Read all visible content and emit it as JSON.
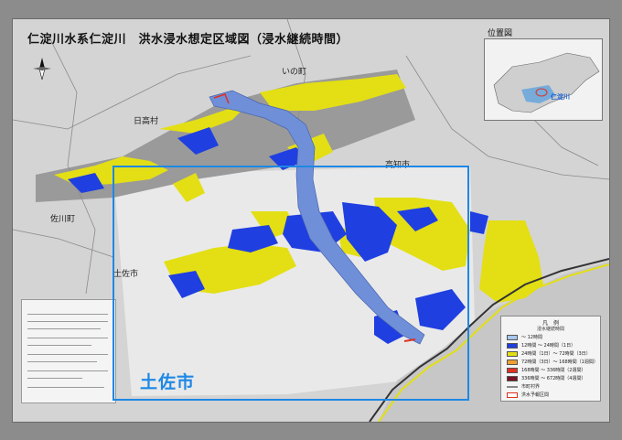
{
  "title": "仁淀川水系仁淀川　洪水浸水想定区域図（浸水継続時間）",
  "place_names": {
    "ino": "いの町",
    "hidaka": "日高村",
    "kochi": "高知市",
    "sakawa": "佐川町",
    "tosa": "土佐市"
  },
  "inset": {
    "title": "位置図",
    "river_label": "仁淀川"
  },
  "highlight_label": "土佐市",
  "colors": {
    "flood_blue": "#1f3fe0",
    "flood_yellow": "#e3df14",
    "river": "#6f8fd8",
    "highlight": "#1e88e5"
  },
  "legend": {
    "title": "凡　例",
    "subtitle": "浸水継続時間",
    "items": [
      {
        "color": "#a6c8f0",
        "text": "～ 12時間"
      },
      {
        "color": "#1f3fe0",
        "text": "12時間 ～ 24時間（1日）"
      },
      {
        "color": "#e3df14",
        "text": "24時間（1日）～ 72時間（3日）"
      },
      {
        "color": "#f0a030",
        "text": "72時間（3日）～ 168時間（1週間）"
      },
      {
        "color": "#e03020",
        "text": "168時間 ～ 336時間（2週間）"
      },
      {
        "color": "#7a1020",
        "text": "336時間 ～ 672時間（4週間）"
      }
    ],
    "boundary_label": "市町村界",
    "target_label": "洪水予報区間"
  }
}
